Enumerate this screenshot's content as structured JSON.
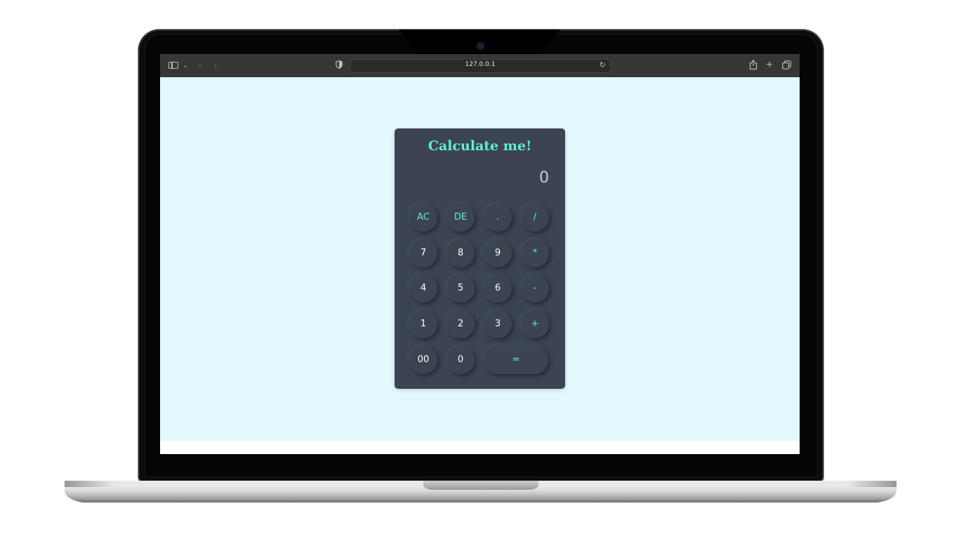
{
  "browser": {
    "url": "127.0.0.1",
    "icons": {
      "sidebar": "sidebar-toggle-icon",
      "chevron": "chevron-down-icon",
      "back": "back-arrow-icon",
      "forward": "forward-arrow-icon",
      "privacy": "shield-icon",
      "reload": "reload-icon",
      "share": "share-icon",
      "new_tab": "plus-icon",
      "tabs": "tabs-overview-icon"
    }
  },
  "calculator": {
    "title": "Calculate me!",
    "display": "0",
    "accent_color": "#5ef0d4",
    "body_color": "#3c4452",
    "page_background": "#e1f8fc",
    "rows": [
      [
        {
          "label": "AC",
          "name": "clear-all-button"
        },
        {
          "label": "DE",
          "name": "delete-button"
        },
        {
          "label": ".",
          "name": "decimal-button"
        },
        {
          "label": "/",
          "name": "divide-button"
        }
      ],
      [
        {
          "label": "7",
          "name": "digit-7-button"
        },
        {
          "label": "8",
          "name": "digit-8-button"
        },
        {
          "label": "9",
          "name": "digit-9-button"
        },
        {
          "label": "*",
          "name": "multiply-button"
        }
      ],
      [
        {
          "label": "4",
          "name": "digit-4-button"
        },
        {
          "label": "5",
          "name": "digit-5-button"
        },
        {
          "label": "6",
          "name": "digit-6-button"
        },
        {
          "label": "-",
          "name": "subtract-button"
        }
      ],
      [
        {
          "label": "1",
          "name": "digit-1-button"
        },
        {
          "label": "2",
          "name": "digit-2-button"
        },
        {
          "label": "3",
          "name": "digit-3-button"
        },
        {
          "label": "+",
          "name": "add-button"
        }
      ],
      [
        {
          "label": "00",
          "name": "double-zero-button"
        },
        {
          "label": "0",
          "name": "digit-0-button"
        },
        {
          "label": "=",
          "name": "equals-button"
        }
      ]
    ]
  }
}
